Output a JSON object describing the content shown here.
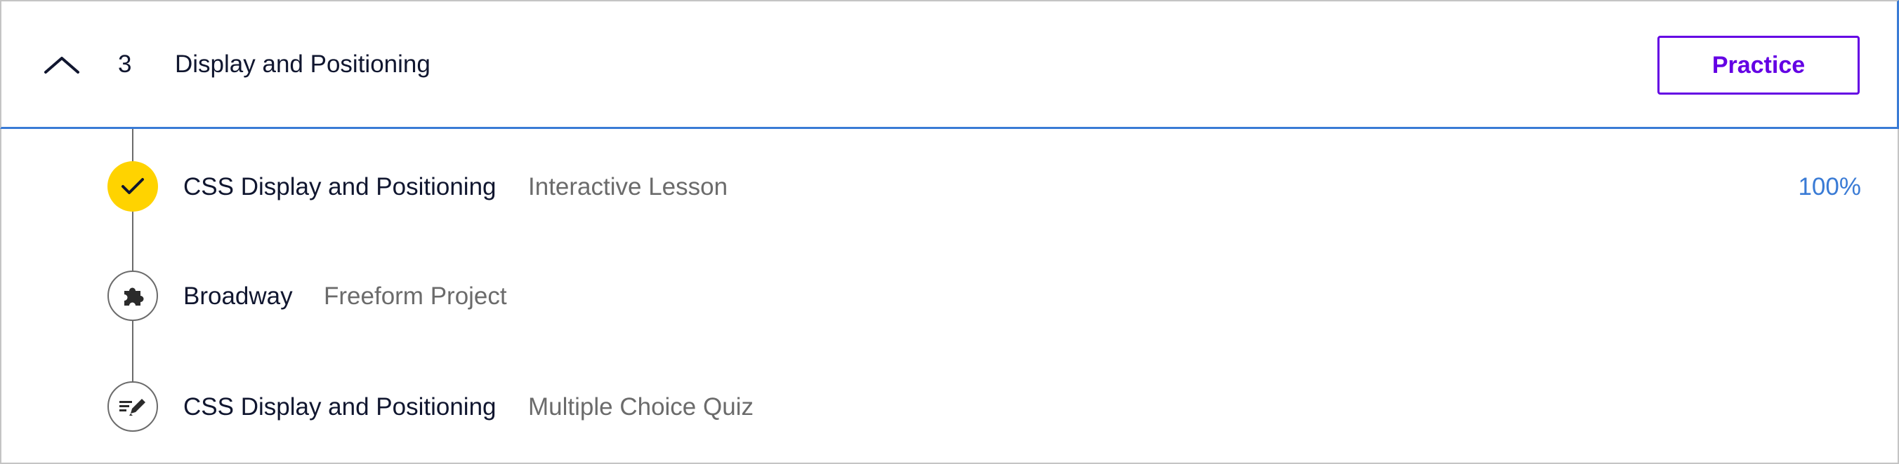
{
  "module": {
    "number": "3",
    "title": "Display and Positioning",
    "practice_label": "Practice",
    "toggle_icon": "chevron-up-icon"
  },
  "lessons": [
    {
      "title": "CSS Display and Positioning",
      "type": "Interactive Lesson",
      "progress": "100%",
      "status": "complete",
      "icon": "check-icon"
    },
    {
      "title": "Broadway",
      "type": "Freeform Project",
      "progress": "",
      "status": "not-started",
      "icon": "puzzle-icon"
    },
    {
      "title": "CSS Display and Positioning",
      "type": "Multiple Choice Quiz",
      "progress": "",
      "status": "not-started",
      "icon": "quiz-pencil-icon"
    }
  ],
  "colors": {
    "accent": "#6400e4",
    "complete": "#ffd300",
    "progress_text": "#3a7bd5",
    "header_focus_border": "#3a7bd5",
    "muted_text": "#6b6b6b"
  }
}
